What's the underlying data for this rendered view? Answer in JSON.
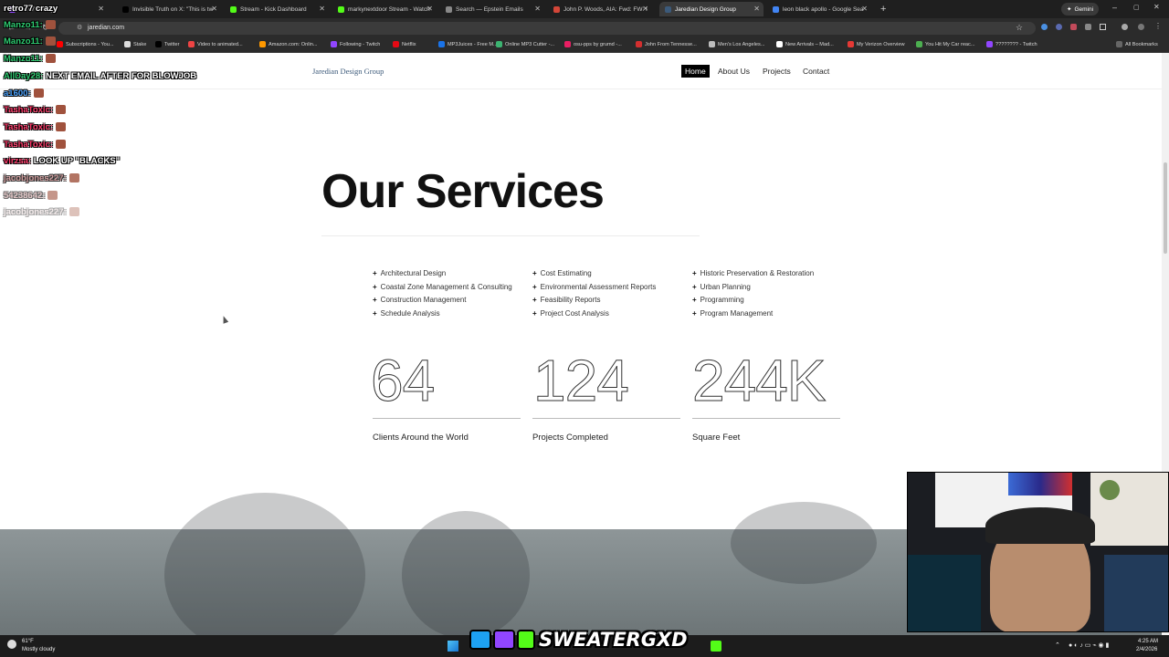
{
  "browser": {
    "tabs": [
      {
        "label": "retro77 crazy",
        "color": "#9146ff"
      },
      {
        "label": "Invisible Truth on X: \"This is tw",
        "color": "#000000"
      },
      {
        "label": "Stream - Kick Dashboard",
        "color": "#53fc18"
      },
      {
        "label": "markynextdoor Stream - Watch",
        "color": "#53fc18"
      },
      {
        "label": "Search — Epstein Emails",
        "color": "#888888"
      },
      {
        "label": "John P. Woods, AIA: Fwd: FW: I",
        "color": "#d44638"
      },
      {
        "label": "Jaredian Design Group",
        "color": "#3c5a7a"
      },
      {
        "label": "leon black apollo - Google Sea",
        "color": "#4285f4"
      }
    ],
    "gemini_label": "Gemini",
    "url": "jaredian.com",
    "bookmarks": [
      "Subscriptions - You...",
      "Stake",
      "Twitter",
      "Video to animated...",
      "Amazon.com: Onlin...",
      "Following - Twitch",
      "Netflix",
      "MP3Juices - Free M...",
      "Online MP3 Cutter -...",
      "osu-pps by grumd -...",
      "John From Tennesse...",
      "Men's Los Angeles...",
      "New Arrivals – Mad...",
      "My Verizon Overview",
      "You Hit My Car reac...",
      "???????? - Twitch"
    ],
    "all_bookmarks": "All Bookmarks"
  },
  "site": {
    "logo": "Jaredian Design Group",
    "nav": [
      "Home",
      "About Us",
      "Projects",
      "Contact"
    ],
    "title": "Our Services",
    "services": {
      "col1": [
        "Architectural Design",
        "Coastal Zone Management & Consulting",
        "Construction Management",
        "Schedule Analysis"
      ],
      "col2": [
        "Cost Estimating",
        "Environmental Assessment Reports",
        "Feasibility Reports",
        "Project Cost Analysis"
      ],
      "col3": [
        "Historic Preservation & Restoration",
        "Urban Planning",
        "Programming",
        "Program Management"
      ]
    },
    "stats": [
      {
        "value": "64",
        "label": "Clients Around the World"
      },
      {
        "value": "124",
        "label": "Projects Completed"
      },
      {
        "value": "244K",
        "label": "Square Feet"
      }
    ]
  },
  "chat": [
    {
      "user": "retro77",
      "msg": "crazy",
      "color": "#ffffff"
    },
    {
      "user": "Manzo11:",
      "msg": "",
      "color": "#2ecc71"
    },
    {
      "user": "Manzo11:",
      "msg": "",
      "color": "#2ecc71"
    },
    {
      "user": "Manzo11:",
      "msg": "",
      "color": "#2ecc71"
    },
    {
      "user": "AllDay28:",
      "msg": "NEXT EMAIL AFTER FOR BLOWJOB",
      "color": "#2ecc71"
    },
    {
      "user": "a1600:",
      "msg": "",
      "color": "#4aa3ff"
    },
    {
      "user": "TashaToxic:",
      "msg": "",
      "color": "#ff3b6b"
    },
    {
      "user": "TashaToxic:",
      "msg": "",
      "color": "#ff3b6b"
    },
    {
      "user": "TashaToxic:",
      "msg": "",
      "color": "#ff3b6b"
    },
    {
      "user": "virzsa:",
      "msg": "LOOK UP \"BLACKS\"",
      "color": "#ff3b6b"
    },
    {
      "user": "jacobjones227:",
      "msg": "",
      "color": "#c08080"
    },
    {
      "user": "54238642:",
      "msg": "",
      "color": "#d0a0a0"
    },
    {
      "user": "jacobjones227:",
      "msg": "",
      "color": "#e0c8c8"
    }
  ],
  "stream_overlay": {
    "handle": "SWEATERGXD"
  },
  "taskbar": {
    "weather_temp": "61°F",
    "weather_desc": "Mostly cloudy",
    "time": "4:25 AM",
    "date": "2/4/2026"
  }
}
